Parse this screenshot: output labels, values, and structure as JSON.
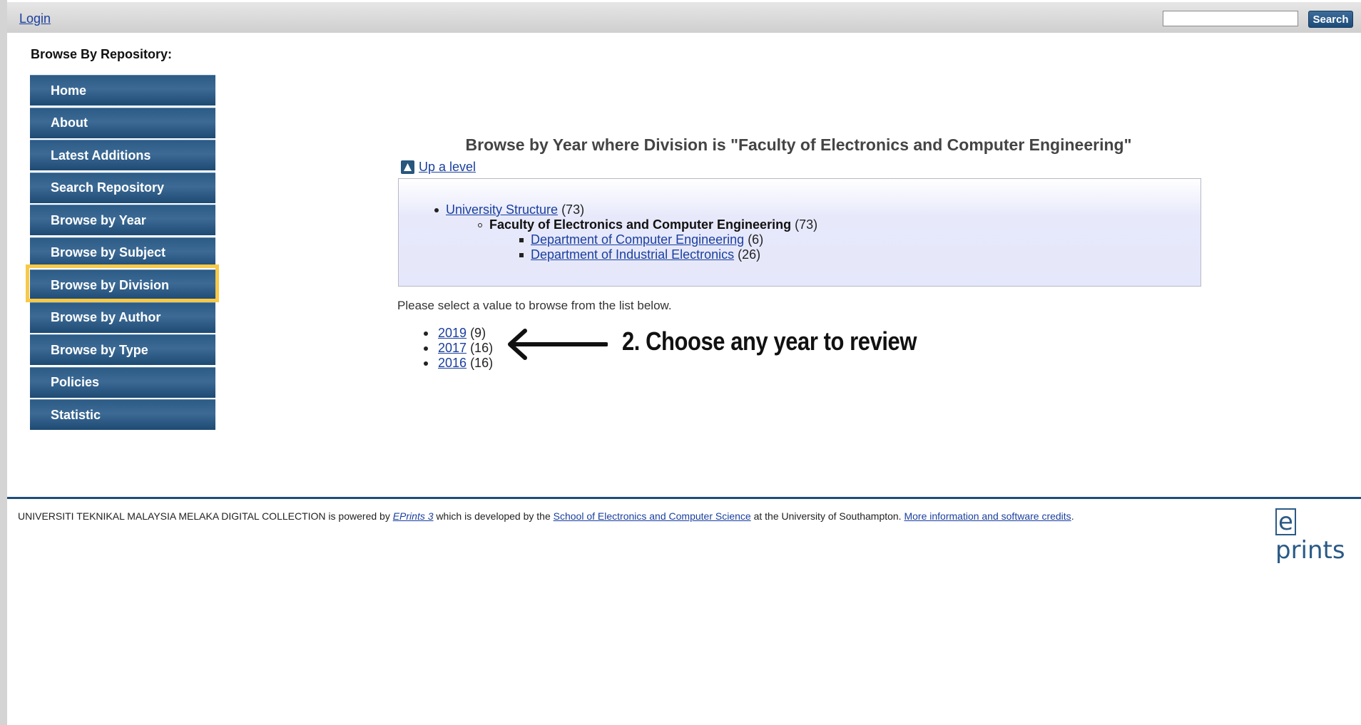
{
  "topbar": {
    "login_label": "Login",
    "search_placeholder": "",
    "search_label": "Search"
  },
  "sidebar": {
    "heading": "Browse By Repository:",
    "items": [
      {
        "label": "Home"
      },
      {
        "label": "About"
      },
      {
        "label": "Latest Additions"
      },
      {
        "label": "Search Repository"
      },
      {
        "label": "Browse by Year"
      },
      {
        "label": "Browse by Subject"
      },
      {
        "label": "Browse by Division",
        "highlighted": true
      },
      {
        "label": "Browse by Author"
      },
      {
        "label": "Browse by Type"
      },
      {
        "label": "Policies"
      },
      {
        "label": "Statistic"
      }
    ]
  },
  "main": {
    "title": "Browse by Year where Division is \"Faculty of Electronics and Computer Engineering\"",
    "up_level": "Up a level",
    "tree": {
      "root": {
        "label": "University Structure",
        "count": "(73)"
      },
      "faculty": {
        "label": "Faculty of Electronics and Computer Engineering",
        "count": "(73)"
      },
      "departments": [
        {
          "label": "Department of Computer Engineering",
          "count": "(6)"
        },
        {
          "label": "Department of Industrial Electronics",
          "count": "(26)"
        }
      ]
    },
    "instruction": "Please select a value to browse from the list below.",
    "years": [
      {
        "year": "2019",
        "count": "(9)"
      },
      {
        "year": "2017",
        "count": "(16)"
      },
      {
        "year": "2016",
        "count": "(16)"
      }
    ]
  },
  "annotation": {
    "text": "2. Choose any year to review",
    "icon": "left-arrow-icon"
  },
  "footer": {
    "org": "UNIVERSITI TEKNIKAL MALAYSIA MELAKA DIGITAL COLLECTION",
    "powered_by": " is powered by ",
    "eprints_link": "EPrints 3",
    "developed_by": " which is developed by the ",
    "school_link": "School of Electronics and Computer Science",
    "at_univ": " at the University of Southampton. ",
    "credits_link": "More information and software credits",
    "period": ".",
    "logo_e": "e",
    "logo_rest": "prints"
  },
  "colors": {
    "nav_blue": "#2c5b86",
    "highlight": "#f7c948",
    "link": "#1a3f9e",
    "tree_box": "#e5e7fa"
  }
}
